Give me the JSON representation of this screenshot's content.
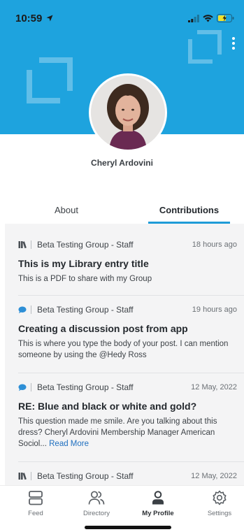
{
  "status_bar": {
    "time": "10:59"
  },
  "profile": {
    "name": "Cheryl Ardovini"
  },
  "tabs": [
    {
      "label": "About",
      "active": false
    },
    {
      "label": "Contributions",
      "active": true
    }
  ],
  "posts": [
    {
      "type": "library",
      "icon": "library-books-icon",
      "group": "Beta Testing Group - Staff",
      "time": "18 hours ago",
      "title": "This is my Library entry title",
      "body": "This is a PDF to share with my Group"
    },
    {
      "type": "discussion",
      "icon": "chat-bubble-icon",
      "group": "Beta Testing Group - Staff",
      "time": "19 hours ago",
      "title": "Creating a discussion post from app",
      "body": "This is where you type the body of your post.  I can mention someone by using the @Hedy Ross"
    },
    {
      "type": "discussion",
      "icon": "chat-bubble-icon",
      "group": "Beta Testing Group - Staff",
      "time": "12 May, 2022",
      "title": "RE: Blue and black or white and gold?",
      "body": "This question made me smile. Are you talking about this dress?    Cheryl Ardovini  Membership Manager  American Sociol...",
      "read_more": "Read More"
    },
    {
      "type": "library",
      "icon": "library-books-icon",
      "group": "Beta Testing Group - Staff",
      "time": "12 May, 2022"
    }
  ],
  "tabbar": [
    {
      "label": "Feed",
      "icon": "feed-icon",
      "active": false
    },
    {
      "label": "Directory",
      "icon": "directory-icon",
      "active": false
    },
    {
      "label": "My Profile",
      "icon": "person-icon",
      "active": true
    },
    {
      "label": "Settings",
      "icon": "gear-icon",
      "active": false
    }
  ],
  "colors": {
    "header_blue": "#1ea3de",
    "tab_underline": "#1e9bd7",
    "link": "#1f6fbf",
    "feed_background": "#f4f4f5"
  }
}
